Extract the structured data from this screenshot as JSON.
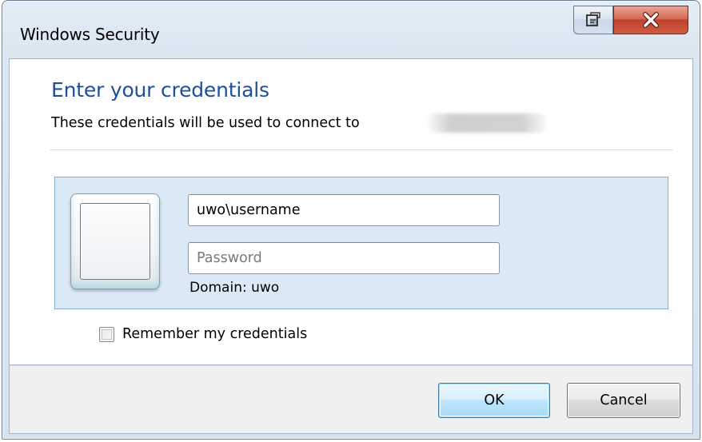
{
  "window": {
    "title": "Windows Security"
  },
  "titlebar": {
    "restore_icon": "restore-icon",
    "close_icon": "close-icon"
  },
  "content": {
    "heading": "Enter your credentials",
    "subline": "These credentials will be used to connect to",
    "blurred_target": "",
    "user_tile_icon": "user-tile-icon"
  },
  "credentials": {
    "username_value": "uwo\\username",
    "username_placeholder": "",
    "password_value": "",
    "password_placeholder": "Password",
    "domain_text": "Domain: uwo"
  },
  "options": {
    "remember_label": "Remember my credentials",
    "remember_checked": false
  },
  "footer": {
    "ok_label": "OK",
    "cancel_label": "Cancel"
  },
  "colors": {
    "heading": "#1e4f9a",
    "panel_background": "#dbe8f6",
    "panel_border": "#87acd6",
    "close_button": "#c0432c"
  }
}
